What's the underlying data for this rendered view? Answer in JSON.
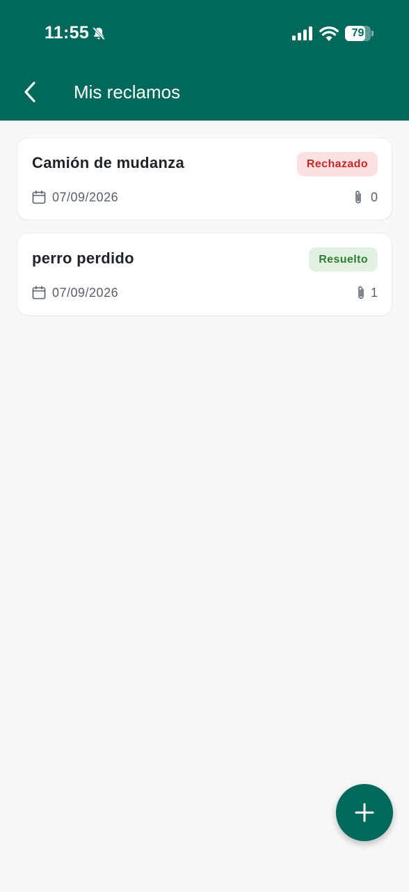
{
  "status_bar": {
    "time": "11:55",
    "battery_level": "79",
    "battery_fraction": 0.79,
    "icons": [
      "bell-muted-icon",
      "signal-icon",
      "wifi-icon",
      "battery-icon"
    ]
  },
  "header": {
    "back_icon": "chevron-left-icon",
    "title": "Mis reclamos"
  },
  "claims": [
    {
      "title": "Camión de mudanza",
      "status": "Rechazado",
      "status_color": "#c62828",
      "date": "07/09/2026",
      "attachments": "0"
    },
    {
      "title": "perro perdido",
      "status": "Resuelto",
      "status_color": "#2e7d32",
      "date": "07/09/2026",
      "attachments": "1"
    }
  ],
  "fab": {
    "icon": "plus-icon"
  },
  "colors": {
    "primary": "#00695c",
    "background": "#f6f8fa",
    "rejected_bg": "#fbe1e1",
    "resolved_bg": "#e3f1e3"
  }
}
